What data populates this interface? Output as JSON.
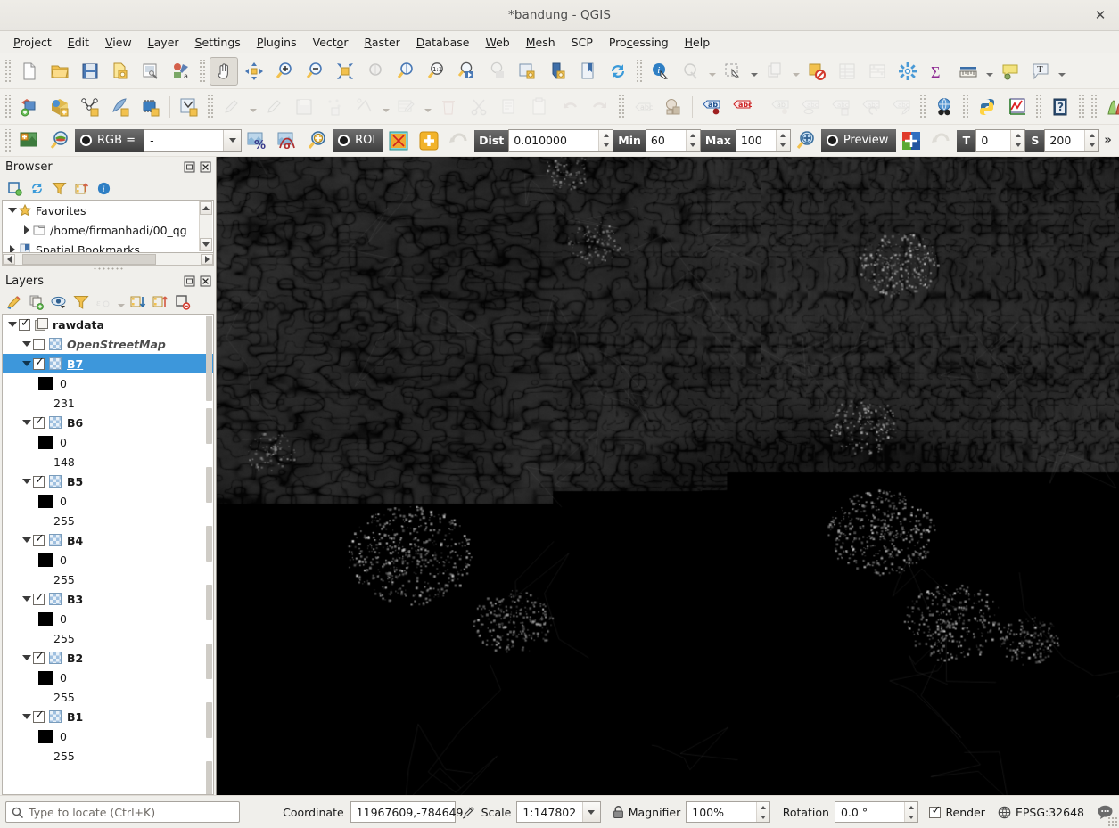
{
  "window": {
    "title": "*bandung - QGIS",
    "close_label": "✕"
  },
  "menubar": {
    "items": [
      {
        "label": "Project",
        "mnemonic": "P"
      },
      {
        "label": "Edit",
        "mnemonic": "E"
      },
      {
        "label": "View",
        "mnemonic": "V"
      },
      {
        "label": "Layer",
        "mnemonic": "L"
      },
      {
        "label": "Settings",
        "mnemonic": "S"
      },
      {
        "label": "Plugins",
        "mnemonic": "P"
      },
      {
        "label": "Vector",
        "mnemonic": "o"
      },
      {
        "label": "Raster",
        "mnemonic": "R"
      },
      {
        "label": "Database",
        "mnemonic": "D"
      },
      {
        "label": "Web",
        "mnemonic": "W"
      },
      {
        "label": "Mesh",
        "mnemonic": "M"
      },
      {
        "label": "SCP",
        "mnemonic": ""
      },
      {
        "label": "Processing",
        "mnemonic": "c"
      },
      {
        "label": "Help",
        "mnemonic": "H"
      }
    ]
  },
  "toolbar_project": {
    "buttons": [
      {
        "name": "new-project-icon",
        "tooltip": "New Project"
      },
      {
        "name": "open-project-icon",
        "tooltip": "Open Project"
      },
      {
        "name": "save-project-icon",
        "tooltip": "Save Project"
      },
      {
        "name": "save-project-as-icon",
        "tooltip": "Save Project As"
      },
      {
        "name": "new-print-layout-icon",
        "tooltip": "New Print Layout"
      },
      {
        "name": "style-manager-icon",
        "tooltip": "Style Manager"
      },
      {
        "name": "pan-map-icon",
        "tooltip": "Pan Map",
        "active": true
      },
      {
        "name": "pan-to-selection-icon",
        "tooltip": "Pan Map to Selection"
      },
      {
        "name": "zoom-in-icon",
        "tooltip": "Zoom In"
      },
      {
        "name": "zoom-out-icon",
        "tooltip": "Zoom Out"
      },
      {
        "name": "zoom-full-icon",
        "tooltip": "Zoom Full"
      },
      {
        "name": "zoom-to-selection-icon",
        "tooltip": "Zoom to Selection",
        "disabled": true
      },
      {
        "name": "zoom-to-layer-icon",
        "tooltip": "Zoom to Layer"
      },
      {
        "name": "zoom-native-icon",
        "tooltip": "Zoom to Native Resolution"
      },
      {
        "name": "zoom-last-icon",
        "tooltip": "Zoom Last"
      },
      {
        "name": "zoom-next-icon",
        "tooltip": "Zoom Next",
        "disabled": true
      },
      {
        "name": "new-map-view-icon",
        "tooltip": "New Map View"
      },
      {
        "name": "new-3d-map-view-icon",
        "tooltip": "New 3D Map View"
      },
      {
        "name": "show-bookmarks-icon",
        "tooltip": "Show Spatial Bookmarks"
      },
      {
        "name": "refresh-icon",
        "tooltip": "Refresh"
      },
      {
        "name": "identify-features-icon",
        "tooltip": "Identify Features"
      },
      {
        "name": "select-features-icon",
        "tooltip": "Select Features",
        "disabled": true
      },
      {
        "name": "select-by-area-icon",
        "tooltip": "Select by Area",
        "disabled": true
      },
      {
        "name": "deselect-features-icon",
        "tooltip": "Deselect Features",
        "disabled": true
      },
      {
        "name": "open-attribute-table-icon",
        "tooltip": "Open Attribute Table",
        "disabled": true
      },
      {
        "name": "field-calculator-icon",
        "tooltip": "Field Calculator",
        "disabled": true
      },
      {
        "name": "processing-toolbox-icon",
        "tooltip": "Processing Toolbox"
      },
      {
        "name": "statistical-summary-icon",
        "tooltip": "Statistical Summary"
      },
      {
        "name": "measure-line-icon",
        "tooltip": "Measure Line"
      },
      {
        "name": "map-tips-icon",
        "tooltip": "Show Map Tips"
      },
      {
        "name": "new-text-annotation-icon",
        "tooltip": "Text Annotation"
      }
    ]
  },
  "toolbar_layers": {
    "buttons": [
      {
        "name": "open-data-source-manager-icon",
        "tooltip": "Open Data Source Manager"
      },
      {
        "name": "add-vector-layer-icon",
        "tooltip": "Add Vector Layer"
      },
      {
        "name": "add-raster-layer-icon",
        "tooltip": "Add Raster Layer"
      },
      {
        "name": "add-mesh-layer-icon",
        "tooltip": "Add Mesh Layer"
      },
      {
        "name": "add-delimited-text-layer-icon",
        "tooltip": "Add Delimited Text Layer"
      },
      {
        "name": "new-virtual-layer-icon",
        "tooltip": "New Virtual Layer"
      },
      {
        "name": "current-edits-icon",
        "tooltip": "Current Edits",
        "disabled": true
      },
      {
        "name": "toggle-editing-icon",
        "tooltip": "Toggle Editing",
        "disabled": true
      },
      {
        "name": "save-layer-edits-icon",
        "tooltip": "Save Layer Edits",
        "disabled": true
      },
      {
        "name": "add-feature-icon",
        "tooltip": "Add Feature",
        "disabled": true
      },
      {
        "name": "vertex-tool-icon",
        "tooltip": "Vertex Tool",
        "disabled": true
      },
      {
        "name": "modify-attributes-icon",
        "tooltip": "Modify Attributes",
        "disabled": true
      },
      {
        "name": "delete-selected-icon",
        "tooltip": "Delete Selected",
        "disabled": true
      },
      {
        "name": "cut-features-icon",
        "tooltip": "Cut Features",
        "disabled": true
      },
      {
        "name": "copy-features-icon",
        "tooltip": "Copy Features",
        "disabled": true
      },
      {
        "name": "paste-features-icon",
        "tooltip": "Paste Features",
        "disabled": true
      },
      {
        "name": "undo-icon",
        "tooltip": "Undo",
        "disabled": true
      },
      {
        "name": "redo-icon",
        "tooltip": "Redo",
        "disabled": true
      },
      {
        "name": "label-toolbar-icon",
        "tooltip": "Label Toolbar",
        "disabled": true
      },
      {
        "name": "layer-styling-icon",
        "tooltip": "Layer Styling"
      },
      {
        "name": "pin-labels-icon",
        "tooltip": "Pin Labels"
      },
      {
        "name": "highlight-pinned-labels-icon",
        "tooltip": "Highlight Pinned Labels"
      },
      {
        "name": "move-label-icon",
        "tooltip": "Move Label",
        "disabled": true
      },
      {
        "name": "show-hide-labels-icon",
        "tooltip": "Show/Hide Labels",
        "disabled": true
      },
      {
        "name": "move-label-diagram-icon",
        "tooltip": "Move Label or Diagram",
        "disabled": true
      },
      {
        "name": "rotate-label-icon",
        "tooltip": "Rotate Label",
        "disabled": true
      },
      {
        "name": "change-label-icon",
        "tooltip": "Change Label",
        "disabled": true
      },
      {
        "name": "metasearch-icon",
        "tooltip": "MetaSearch"
      },
      {
        "name": "python-console-icon",
        "tooltip": "Python Console"
      },
      {
        "name": "plot-icon",
        "tooltip": "Data Plotly"
      },
      {
        "name": "help-icon",
        "tooltip": "Help"
      },
      {
        "name": "semi-automatic-classification-icon",
        "tooltip": "SCP"
      }
    ],
    "overflow_label": "»"
  },
  "toolbar_scp": {
    "buttons": [
      {
        "name": "scp-working-toolbar-icon"
      },
      {
        "name": "zoom-to-band-set-icon"
      }
    ],
    "rgb_label": "RGB =",
    "rgb_value": "-",
    "after_rgb_buttons": [
      {
        "name": "local-cumulative-cut-stretch-icon"
      },
      {
        "name": "local-std-dev-stretch-icon"
      },
      {
        "name": "zoom-to-roi-icon"
      }
    ],
    "roi_label": "ROI",
    "roi_buttons": [
      {
        "name": "create-roi-polygon-icon"
      },
      {
        "name": "activate-roi-pointer-icon"
      },
      {
        "name": "redo-roi-icon"
      }
    ],
    "dist_label": "Dist",
    "dist_value": "0.010000",
    "min_label": "Min",
    "min_value": "60",
    "max_label": "Max",
    "max_value": "100",
    "preview_zoom_icon": "zoom-to-preview-icon",
    "preview_label": "Preview",
    "preview_buttons": [
      {
        "name": "show-preview-icon"
      },
      {
        "name": "redo-preview-icon"
      }
    ],
    "t_label": "T",
    "t_value": "0",
    "s_label": "S",
    "s_value": "200",
    "overflow_label": "»",
    "end_button": {
      "name": "scp-dock-icon"
    },
    "end_overflow_label": "»"
  },
  "browser_panel": {
    "title": "Browser",
    "float_icon": "float-panel-icon",
    "close_icon": "close-panel-icon",
    "tools": [
      {
        "name": "add-selected-layers-icon"
      },
      {
        "name": "refresh-browser-icon"
      },
      {
        "name": "filter-browser-icon"
      },
      {
        "name": "collapse-all-icon"
      },
      {
        "name": "browser-properties-icon"
      }
    ],
    "tree": [
      {
        "label": "Favorites",
        "icon": "star-icon",
        "indent": 1,
        "expanded": true
      },
      {
        "label": "/home/firmanhadi/00_qg",
        "icon": "folder-icon",
        "indent": 2,
        "expanded": false
      },
      {
        "label": "Spatial Bookmarks",
        "icon": "bookmark-icon",
        "indent": 1,
        "expanded": false
      }
    ]
  },
  "layers_panel": {
    "title": "Layers",
    "float_icon": "float-panel-icon",
    "close_icon": "close-panel-icon",
    "tools": [
      {
        "name": "open-layer-styling-panel-icon"
      },
      {
        "name": "add-group-icon"
      },
      {
        "name": "manage-layer-visibility-icon"
      },
      {
        "name": "filter-legend-icon"
      },
      {
        "name": "filter-legend-by-expression-icon",
        "disabled": true
      },
      {
        "name": "expand-all-icon"
      },
      {
        "name": "collapse-all-icon"
      },
      {
        "name": "remove-layer-group-icon"
      }
    ],
    "tree": [
      {
        "type": "group",
        "label": "rawdata",
        "checked": true,
        "expanded": true,
        "indent": 1,
        "icon": "group-icon"
      },
      {
        "type": "layer",
        "label": "OpenStreetMap",
        "checked": false,
        "expanded": true,
        "indent": 2,
        "icon": "raster-icon",
        "italic": true
      },
      {
        "type": "layer",
        "label": "B7",
        "checked": true,
        "expanded": true,
        "indent": 2,
        "icon": "raster-icon",
        "selected": true
      },
      {
        "type": "legend-min",
        "label": "0",
        "indent": 3,
        "swatch": "#000000"
      },
      {
        "type": "legend-max",
        "label": "231",
        "indent": 4
      },
      {
        "type": "layer",
        "label": "B6",
        "checked": true,
        "expanded": true,
        "indent": 2,
        "icon": "raster-icon"
      },
      {
        "type": "legend-min",
        "label": "0",
        "indent": 3,
        "swatch": "#000000"
      },
      {
        "type": "legend-max",
        "label": "148",
        "indent": 4
      },
      {
        "type": "layer",
        "label": "B5",
        "checked": true,
        "expanded": true,
        "indent": 2,
        "icon": "raster-icon"
      },
      {
        "type": "legend-min",
        "label": "0",
        "indent": 3,
        "swatch": "#000000"
      },
      {
        "type": "legend-max",
        "label": "255",
        "indent": 4
      },
      {
        "type": "layer",
        "label": "B4",
        "checked": true,
        "expanded": true,
        "indent": 2,
        "icon": "raster-icon"
      },
      {
        "type": "legend-min",
        "label": "0",
        "indent": 3,
        "swatch": "#000000"
      },
      {
        "type": "legend-max",
        "label": "255",
        "indent": 4
      },
      {
        "type": "layer",
        "label": "B3",
        "checked": true,
        "expanded": true,
        "indent": 2,
        "icon": "raster-icon"
      },
      {
        "type": "legend-min",
        "label": "0",
        "indent": 3,
        "swatch": "#000000"
      },
      {
        "type": "legend-max",
        "label": "255",
        "indent": 4
      },
      {
        "type": "layer",
        "label": "B2",
        "checked": true,
        "expanded": true,
        "indent": 2,
        "icon": "raster-icon"
      },
      {
        "type": "legend-min",
        "label": "0",
        "indent": 3,
        "swatch": "#000000"
      },
      {
        "type": "legend-max",
        "label": "255",
        "indent": 4
      },
      {
        "type": "layer",
        "label": "B1",
        "checked": true,
        "expanded": true,
        "indent": 2,
        "icon": "raster-icon"
      },
      {
        "type": "legend-min",
        "label": "0",
        "indent": 3,
        "swatch": "#000000"
      },
      {
        "type": "legend-max",
        "label": "255",
        "indent": 4
      }
    ]
  },
  "statusbar": {
    "locator_placeholder": "Type to locate (Ctrl+K)",
    "coordinate_label": "Coordinate",
    "coordinate_value": "11967609,-784649",
    "toggle_extents_icon": "toggle-extents-icon",
    "scale_label": "Scale",
    "scale_value": "1:147802",
    "lock_scale_icon": "lock-icon",
    "magnifier_label": "Magnifier",
    "magnifier_value": "100%",
    "rotation_label": "Rotation",
    "rotation_value": "0.0 °",
    "render_label": "Render",
    "render_checked": true,
    "crs_label": "EPSG:32648",
    "crs_icon": "globe-icon",
    "messages_icon": "messages-icon"
  },
  "colors": {
    "selection_blue": "#3d97db",
    "chrome": "#f0efeb",
    "map_background": "#121212"
  }
}
